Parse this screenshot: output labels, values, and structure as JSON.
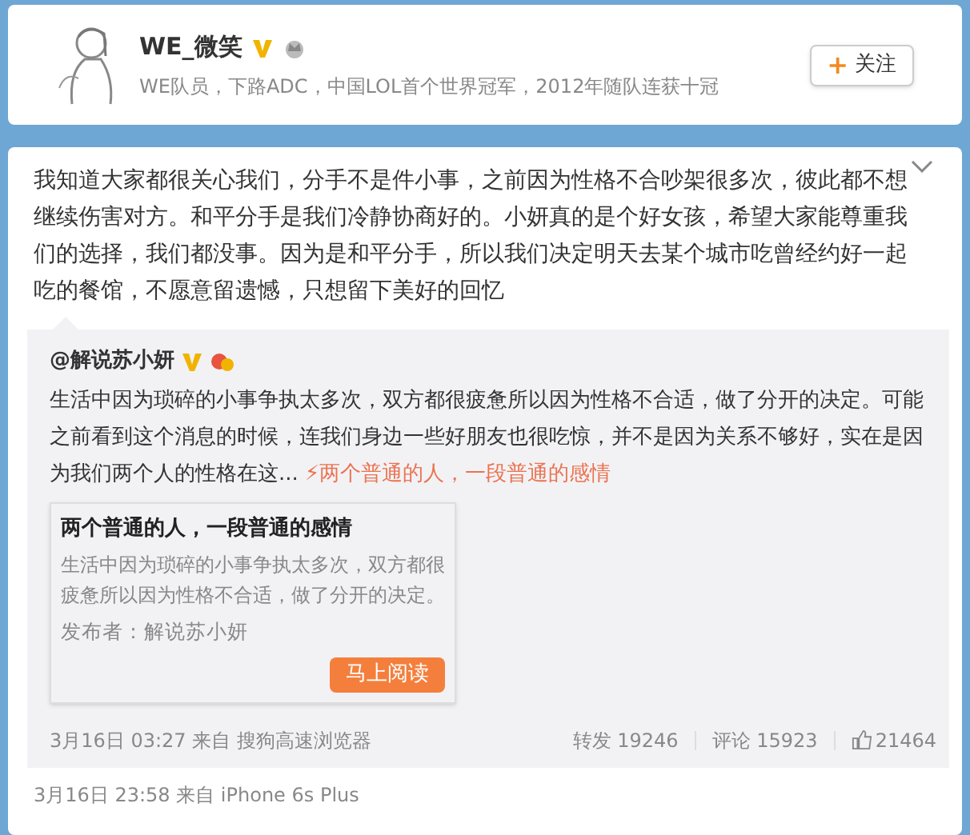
{
  "profile": {
    "name": "WE_微笑",
    "bio": "WE队员，下路ADC，中国LOL首个世界冠军，2012年随队连获十冠",
    "verified": true,
    "follow_button": {
      "icon": "+",
      "label": "关注"
    }
  },
  "post": {
    "text": "我知道大家都很关心我们，分手不是件小事，之前因为性格不合吵架很多次，彼此都不想继续伤害对方。和平分手是我们冷静协商好的。小妍真的是个好女孩，希望大家能尊重我们的选择，我们都没事。因为是和平分手，所以我们决定明天去某个城市吃曾经约好一起吃的餐馆，不愿意留遗憾，只想留下美好的回忆",
    "repost": {
      "author": "@解说苏小妍",
      "verified": true,
      "text": "生活中因为琐碎的小事争执太多次，双方都很疲惫所以因为性格不合适，做了分开的决定。可能之前看到这个消息的时候，连我们身边一些好朋友也很吃惊，并不是因为关系不够好，实在是因为我们两个人的性格在这...",
      "link_icon": "⚡",
      "link": "两个普通的人，一段普通的感情",
      "article": {
        "title": "两个普通的人，一段普通的感情",
        "summary": "生活中因为琐碎的小事争执太多次，双方都很疲惫所以因为性格不合适，做了分开的决定。",
        "publisher": "发布者：解说苏小妍",
        "button": "马上阅读"
      },
      "time": "3月16日 03:27 来自 搜狗高速浏览器",
      "reposts": "转发 19246",
      "comments": "评论 15923",
      "likes": "21464"
    },
    "time": "3月16日 23:58 来自 iPhone 6s Plus"
  }
}
